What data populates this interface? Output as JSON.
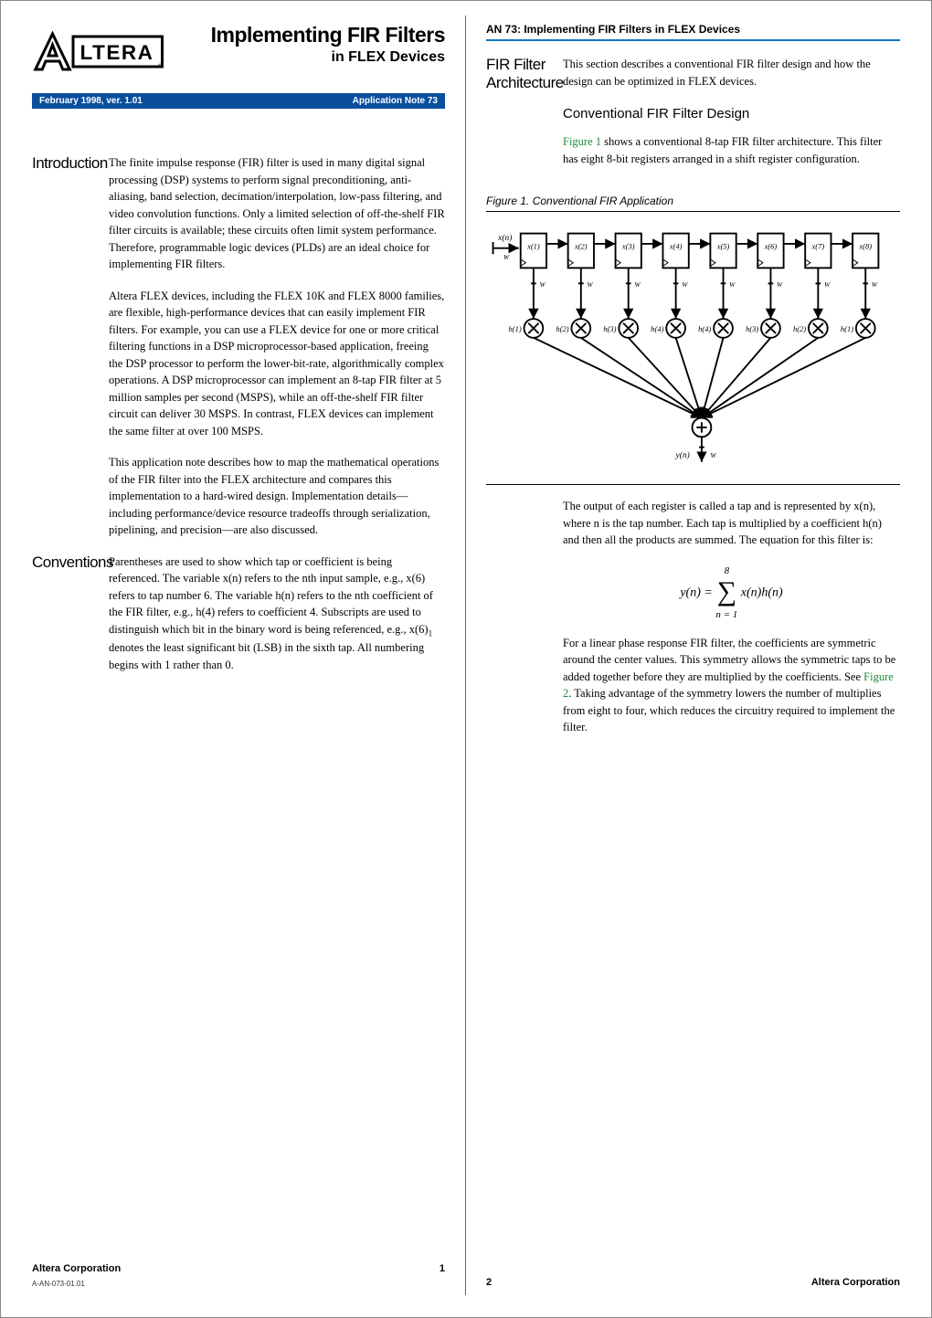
{
  "meta": {
    "title_main": "Implementing FIR Filters",
    "title_sub": "in FLEX Devices",
    "running_head": "AN 73: Implementing FIR Filters in FLEX Devices",
    "ver_left": "February 1998, ver. 1.01",
    "ver_right": "Application Note 73",
    "logo_text": "ALTERA",
    "doc_id": "A-AN-073-01.01",
    "corp": "Altera Corporation",
    "page_left": "1",
    "page_right": "2"
  },
  "left": {
    "intro_head": "Introduction",
    "intro_p1": "The finite impulse response (FIR) filter is used in many digital signal processing (DSP) systems to perform signal preconditioning, anti-aliasing, band selection, decimation/interpolation, low-pass filtering, and video convolution functions. Only a limited selection of off-the-shelf FIR filter circuits is available; these circuits often limit system performance. Therefore, programmable logic devices (PLDs) are an ideal choice for implementing FIR filters.",
    "intro_p2": "Altera FLEX devices, including the FLEX 10K and FLEX 8000 families, are flexible, high-performance devices that can easily implement FIR filters. For example, you can use a FLEX device for one or more critical filtering functions in a DSP microprocessor-based application, freeing the DSP processor to perform the lower-bit-rate, algorithmically complex operations. A DSP microprocessor can implement an 8-tap FIR filter at 5 million samples per second (MSPS), while an off-the-shelf FIR filter circuit can deliver 30 MSPS. In contrast, FLEX devices can implement the same filter at over 100 MSPS.",
    "intro_p3": "This application note describes how to map the mathematical operations of the FIR filter into the FLEX architecture and compares this implementation to a hard-wired design. Implementation details—including performance/device resource tradeoffs through serialization, pipelining, and precision—are also discussed.",
    "conv_head": "Conventions",
    "conv_p1a": "Parentheses are used to show which tap or coefficient is being referenced. The variable x(n) refers to the nth input sample, e.g., x(6) refers to tap number 6. The variable h(n) refers to the nth coefficient of the FIR filter, e.g., h(4) refers to coefficient 4. Subscripts are used to distinguish which bit in the binary word is being referenced, e.g., x(6)",
    "conv_p1_sub": "1",
    "conv_p1b": " denotes the least significant bit (LSB) in the sixth tap. All numbering begins with 1 rather than 0."
  },
  "right": {
    "arch_head": "FIR Filter Architecture",
    "arch_p1": "This section describes a conventional FIR filter design and how the design can be optimized in FLEX devices.",
    "conv_sub": "Conventional FIR Filter Design",
    "conv_intro_a": "Figure 1",
    "conv_intro_b": " shows a conventional 8-tap FIR filter architecture. This filter has eight 8-bit registers arranged in a shift register configuration.",
    "fig_caption": "Figure 1. Conventional FIR Application",
    "taps": [
      "x(1)",
      "x(2)",
      "x(3)",
      "x(4)",
      "x(5)",
      "x(6)",
      "x(7)",
      "x(8)"
    ],
    "coeffs": [
      "h(1)",
      "h(2)",
      "h(3)",
      "h(4)",
      "h(4)",
      "h(3)",
      "h(2)",
      "h(1)"
    ],
    "xin": "x(n)",
    "yout": "y(n)",
    "w": "W",
    "after_fig_p1": "The output of each register is called a tap and is represented by x(n), where n is the tap number. Each tap is multiplied by a coefficient h(n) and then all the products are summed. The equation for this filter is:",
    "eq": {
      "lhs": "y(n) = ",
      "top": "8",
      "bot": "n = 1",
      "rhs": "x(n)h(n)"
    },
    "after_eq_p1a": "For a linear phase response FIR filter, the coefficients are symmetric around the center values. This symmetry allows the symmetric taps to be added together before they are multiplied by the coefficients. See ",
    "after_eq_link": "Figure 2",
    "after_eq_p1b": ". Taking advantage of the symmetry lowers the number of multiplies from eight to four, which reduces the circuitry required to implement the filter."
  },
  "chart_data": {
    "type": "diagram",
    "description": "8-tap FIR filter: x(n) enters a chain of 8 shift registers x(1..8); each register output goes to a multiplier with coefficient h(1),h(2),h(3),h(4),h(4),h(3),h(2),h(1); multiplier outputs sum to produce y(n). Bus widths labeled W.",
    "taps": 8,
    "registers": [
      "x(1)",
      "x(2)",
      "x(3)",
      "x(4)",
      "x(5)",
      "x(6)",
      "x(7)",
      "x(8)"
    ],
    "coefficients": [
      "h(1)",
      "h(2)",
      "h(3)",
      "h(4)",
      "h(4)",
      "h(3)",
      "h(2)",
      "h(1)"
    ],
    "input": "x(n)",
    "output": "y(n)",
    "bus_label": "W"
  }
}
